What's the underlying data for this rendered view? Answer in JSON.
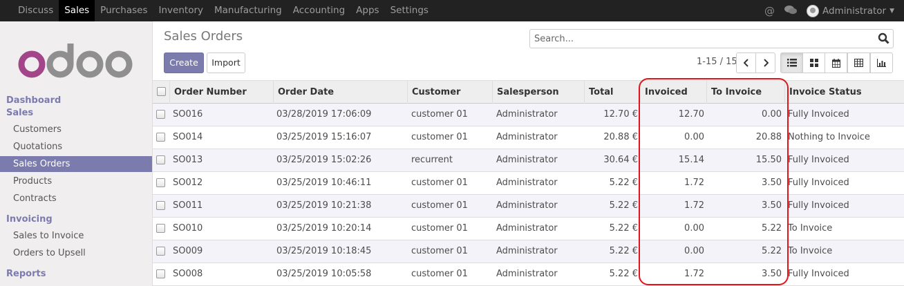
{
  "topbar": {
    "menu": [
      "Discuss",
      "Sales",
      "Purchases",
      "Inventory",
      "Manufacturing",
      "Accounting",
      "Apps",
      "Settings"
    ],
    "active": "Sales",
    "user": "Administrator"
  },
  "sidebar": {
    "logo_text": "odoo",
    "sections": [
      {
        "heading": "Dashboard"
      },
      {
        "heading": "Sales",
        "items": [
          "Customers",
          "Quotations",
          "Sales Orders",
          "Products",
          "Contracts"
        ],
        "active": "Sales Orders"
      },
      {
        "heading": "Invoicing",
        "items": [
          "Sales to Invoice",
          "Orders to Upsell"
        ]
      },
      {
        "heading": "Reports"
      }
    ]
  },
  "control": {
    "title": "Sales Orders",
    "create_label": "Create",
    "import_label": "Import",
    "search_placeholder": "Search...",
    "pager": "1-15 / 15"
  },
  "table": {
    "columns": [
      "Order Number",
      "Order Date",
      "Customer",
      "Salesperson",
      "Total",
      "Invoiced",
      "To Invoice",
      "Invoice Status"
    ],
    "rows": [
      [
        "SO016",
        "03/28/2019 17:06:09",
        "customer 01",
        "Administrator",
        "12.70 €",
        "12.70",
        "0.00",
        "Fully Invoiced"
      ],
      [
        "SO014",
        "03/25/2019 15:16:07",
        "customer 01",
        "Administrator",
        "20.88 €",
        "0.00",
        "20.88",
        "Nothing to Invoice"
      ],
      [
        "SO013",
        "03/25/2019 15:02:26",
        "recurrent",
        "Administrator",
        "30.64 €",
        "15.14",
        "15.50",
        "Fully Invoiced"
      ],
      [
        "SO012",
        "03/25/2019 10:46:11",
        "customer 01",
        "Administrator",
        "5.22 €",
        "1.72",
        "3.50",
        "Fully Invoiced"
      ],
      [
        "SO011",
        "03/25/2019 10:21:38",
        "customer 01",
        "Administrator",
        "5.22 €",
        "1.72",
        "3.50",
        "Fully Invoiced"
      ],
      [
        "SO010",
        "03/25/2019 10:20:14",
        "customer 01",
        "Administrator",
        "5.22 €",
        "0.00",
        "5.22",
        "To Invoice"
      ],
      [
        "SO009",
        "03/25/2019 10:18:45",
        "customer 01",
        "Administrator",
        "5.22 €",
        "0.00",
        "5.22",
        "To Invoice"
      ],
      [
        "SO008",
        "03/25/2019 10:05:58",
        "customer 01",
        "Administrator",
        "5.22 €",
        "1.72",
        "3.50",
        "Fully Invoiced"
      ]
    ]
  },
  "colors": {
    "brand": "#7c7bad",
    "logo_o": "#a24689",
    "logo_doo": "#8f8f8f",
    "highlight": "#e0151b"
  }
}
